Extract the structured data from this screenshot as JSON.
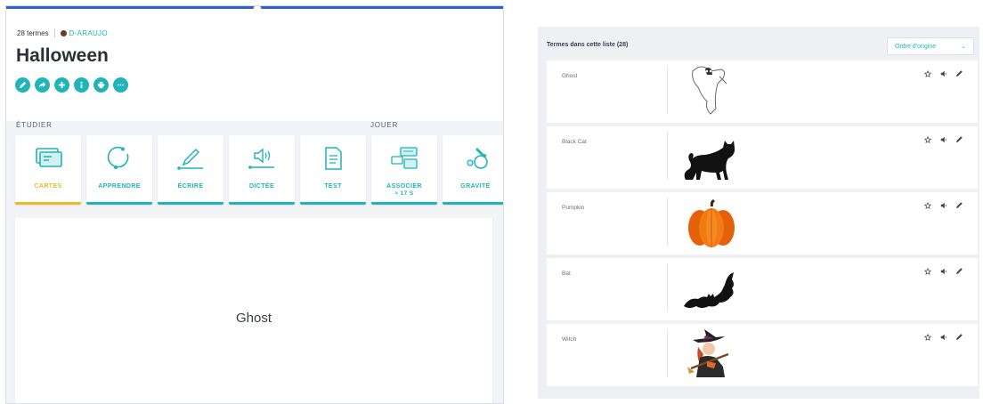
{
  "set": {
    "term_count": "28 termes",
    "author": "D-ARAUJO",
    "title": "Halloween"
  },
  "action_buttons": [
    "edit-icon",
    "share-icon",
    "add-icon",
    "info-icon",
    "print-icon",
    "more-icon"
  ],
  "sections": {
    "study": "ÉTUDIER",
    "play": "JOUER"
  },
  "modes": [
    {
      "label": "CARTES",
      "icon": "flashcards-icon",
      "active": true
    },
    {
      "label": "APPRENDRE",
      "icon": "learn-icon"
    },
    {
      "label": "ÉCRIRE",
      "icon": "write-icon"
    },
    {
      "label": "DICTÉE",
      "icon": "dictation-icon"
    },
    {
      "label": "TEST",
      "icon": "test-icon"
    },
    {
      "label": "ASSOCIER",
      "sub": "≈ 17 S",
      "icon": "match-icon"
    },
    {
      "label": "GRAVITÉ",
      "icon": "gravity-icon"
    }
  ],
  "flashcard": {
    "word": "Ghost"
  },
  "term_list": {
    "header": "Termes dans cette liste (28)",
    "sort_label": "Ordre d'origine",
    "terms": [
      {
        "word": "Ghost",
        "image": "ghost-drawing"
      },
      {
        "word": "Black Cat",
        "image": "black-cat-silhouette"
      },
      {
        "word": "Pumpkin",
        "image": "pumpkin-image"
      },
      {
        "word": "Bat",
        "image": "bat-silhouette"
      },
      {
        "word": "Witch",
        "image": "witch-image"
      }
    ]
  },
  "colors": {
    "accent": "#1fb4b8",
    "active": "#f2b824",
    "pumpkin": "#ef6c0a"
  }
}
